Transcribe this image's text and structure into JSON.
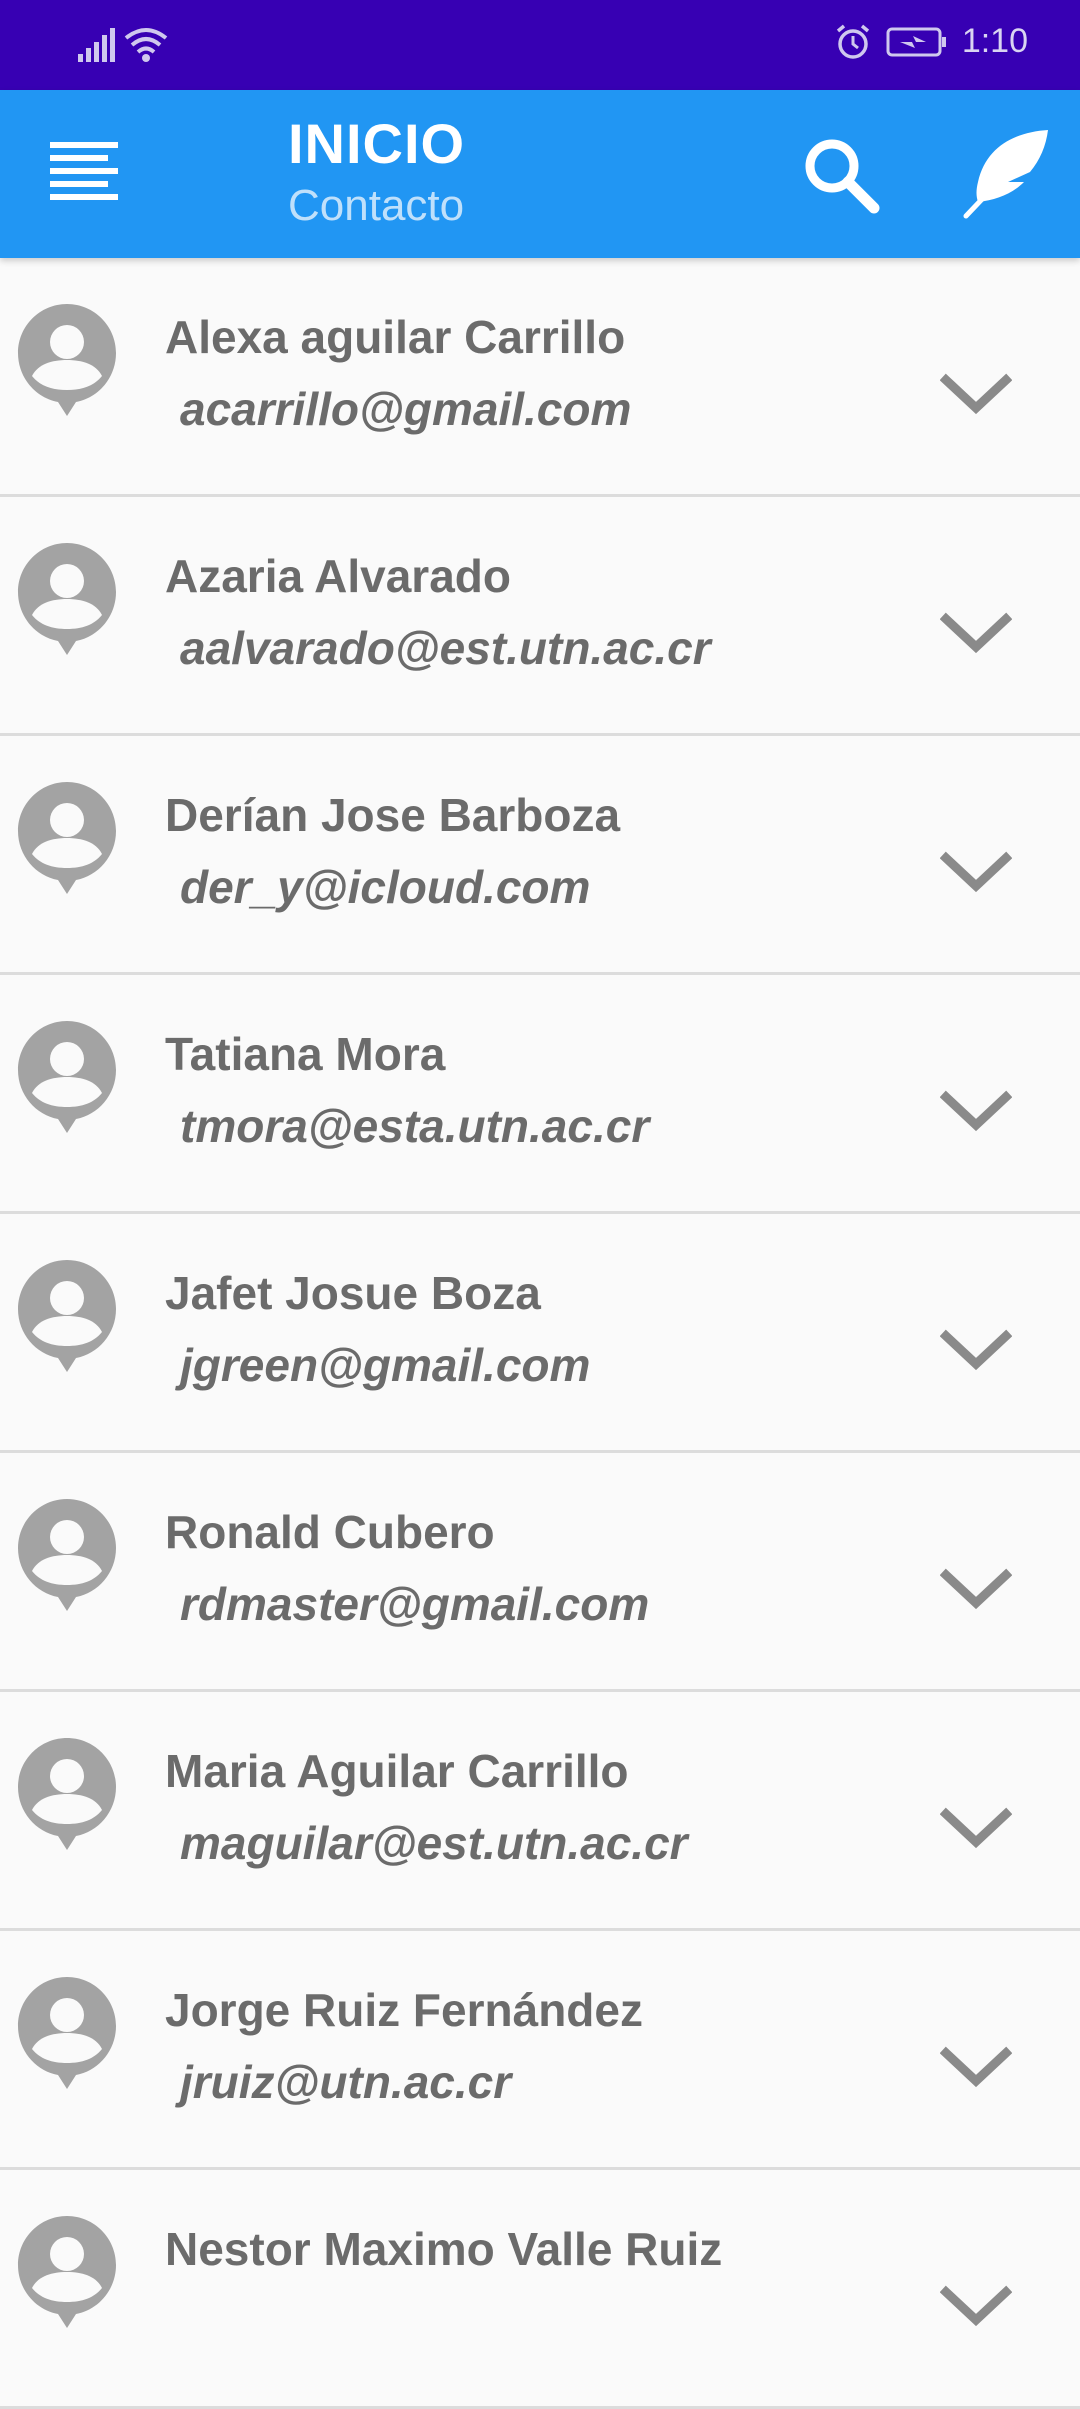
{
  "status_bar": {
    "time": "1:10",
    "icons": [
      "signal-icon",
      "wifi-icon",
      "alarm-icon",
      "battery-charging-icon"
    ]
  },
  "app_bar": {
    "title": "INICIO",
    "subtitle": "Contacto",
    "icons": [
      "menu-icon",
      "search-icon",
      "feather-icon"
    ],
    "color": "#2196f3"
  },
  "colors": {
    "status_bar": "#3700b3",
    "text": "#6b6b6b",
    "divider": "#dcdcdc",
    "background": "#fafafa"
  },
  "contacts": [
    {
      "name": "Alexa aguilar Carrillo",
      "email": "acarrillo@gmail.com"
    },
    {
      "name": "Azaria Alvarado",
      "email": "aalvarado@est.utn.ac.cr"
    },
    {
      "name": "Derían Jose Barboza",
      "email": "der_y@icloud.com"
    },
    {
      "name": "Tatiana Mora",
      "email": "tmora@esta.utn.ac.cr"
    },
    {
      "name": "Jafet Josue Boza",
      "email": "jgreen@gmail.com"
    },
    {
      "name": "Ronald Cubero",
      "email": "rdmaster@gmail.com"
    },
    {
      "name": "Maria Aguilar Carrillo",
      "email": "maguilar@est.utn.ac.cr"
    },
    {
      "name": "Jorge Ruiz Fernández",
      "email": "jruiz@utn.ac.cr"
    },
    {
      "name": "Nestor Maximo Valle Ruiz",
      "email": ""
    }
  ]
}
